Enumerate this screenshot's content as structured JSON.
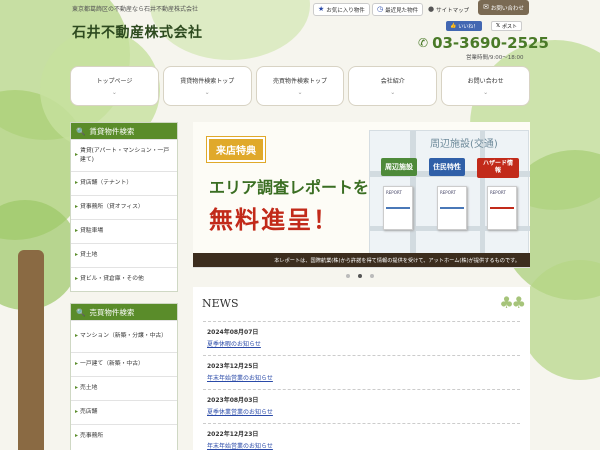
{
  "header": {
    "tagline": "東京都葛飾区の不動産なら石井不動産株式会社",
    "logo": "石井不動産株式会社",
    "favorites": "お気に入り物件",
    "recent": "最近見た物件",
    "sitemap": "サイトマップ",
    "contact": "お問い合わせ",
    "fb_like": "いいね！",
    "x_post": "ポスト",
    "phone": "03-3690-2525",
    "hours": "営業時間/9:00～18:00"
  },
  "gnav": [
    {
      "label": "トップページ"
    },
    {
      "label": "賃貸物件検索トップ"
    },
    {
      "label": "売買物件検索トップ"
    },
    {
      "label": "会社紹介"
    },
    {
      "label": "お問い合わせ"
    }
  ],
  "sidebar": {
    "rent_title": "賃貸物件検索",
    "rent_items": [
      {
        "label": "賃貸(アパート・マンション・一戸建て)"
      },
      {
        "label": "貸店舗（テナント）"
      },
      {
        "label": "貸事務所（貸オフィス）"
      },
      {
        "label": "貸駐車場"
      },
      {
        "label": "貸土地"
      },
      {
        "label": "貸ビル・貸倉庫・その他"
      }
    ],
    "sale_title": "売買物件検索",
    "sale_items": [
      {
        "label": "マンション（新築・分譲・中古）"
      },
      {
        "label": "一戸建て（新築・中古）"
      },
      {
        "label": "売土地"
      },
      {
        "label": "売店舗"
      },
      {
        "label": "売事務所"
      }
    ]
  },
  "banner": {
    "tag": "来店特典",
    "line1": "エリア調査レポートを",
    "line2": "無料進呈！",
    "map_label": "周辺施設(交通)",
    "pill1": "周辺施設",
    "pill2": "住民特性",
    "pill3": "ハザード情報",
    "report": "REPORT",
    "footer": "本レポートは、国際航業(株)から許諾を得て情報の提供を受けて、アットホーム(株)が提供するものです。"
  },
  "news": {
    "title": "NEWS",
    "items": [
      {
        "date": "2024年08月07日",
        "text": "夏季休暇のお知らせ"
      },
      {
        "date": "2023年12月25日",
        "text": "年末年始営業のお知らせ"
      },
      {
        "date": "2023年08月03日",
        "text": "夏季休業営業のお知らせ"
      },
      {
        "date": "2022年12月23日",
        "text": "年末年始営業のお知らせ"
      }
    ]
  },
  "colors": {
    "accent": "#5a8c2a",
    "phone": "#4a7a28",
    "banner_red": "#c22a1a",
    "tag": "#e0a92a"
  }
}
